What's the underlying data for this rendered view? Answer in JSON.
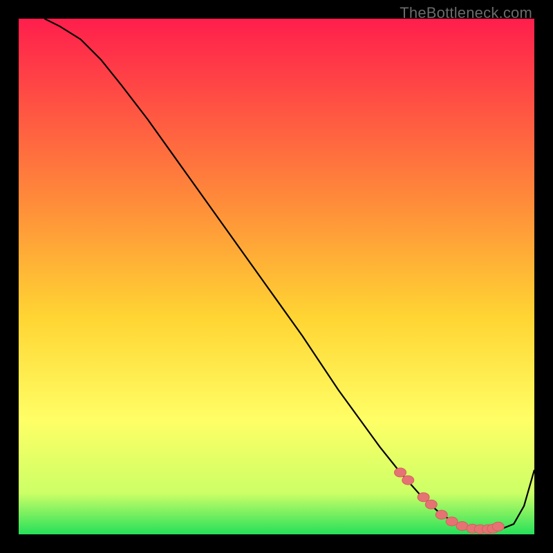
{
  "watermark": "TheBottleneck.com",
  "colors": {
    "black": "#000000",
    "curve": "#000000",
    "marker_fill": "#e57373",
    "marker_stroke": "#d45f5f",
    "grad_top": "#ff1e4c",
    "grad_mid1": "#ff8a3a",
    "grad_mid2": "#ffd533",
    "grad_mid3": "#ffff66",
    "grad_mid4": "#ccff66",
    "grad_bottom": "#26e05a"
  },
  "chart_data": {
    "type": "line",
    "title": "",
    "xlabel": "",
    "ylabel": "",
    "xlim": [
      0,
      100
    ],
    "ylim": [
      0,
      100
    ],
    "series": [
      {
        "name": "bottleneck-curve",
        "x": [
          5,
          8,
          12,
          16,
          20,
          25,
          30,
          35,
          40,
          45,
          50,
          55,
          58,
          62,
          66,
          70,
          74,
          78,
          82,
          86,
          88,
          90,
          92,
          94,
          96,
          98,
          100
        ],
        "y": [
          100,
          98.5,
          96,
          92,
          87,
          80.5,
          73.5,
          66.5,
          59.5,
          52.5,
          45.5,
          38.5,
          34,
          28,
          22.5,
          17,
          12,
          7.5,
          3.8,
          1.6,
          1.1,
          1.0,
          1.0,
          1.2,
          2.0,
          5.5,
          12.5
        ]
      }
    ],
    "markers": {
      "name": "highlight-dots",
      "x": [
        74.0,
        75.5,
        78.5,
        80.0,
        82.0,
        84.0,
        86.0,
        88.0,
        89.5,
        91.0,
        92.0,
        93.0
      ],
      "y": [
        12.0,
        10.5,
        7.2,
        5.8,
        3.8,
        2.5,
        1.6,
        1.1,
        1.0,
        1.0,
        1.1,
        1.5
      ]
    }
  }
}
